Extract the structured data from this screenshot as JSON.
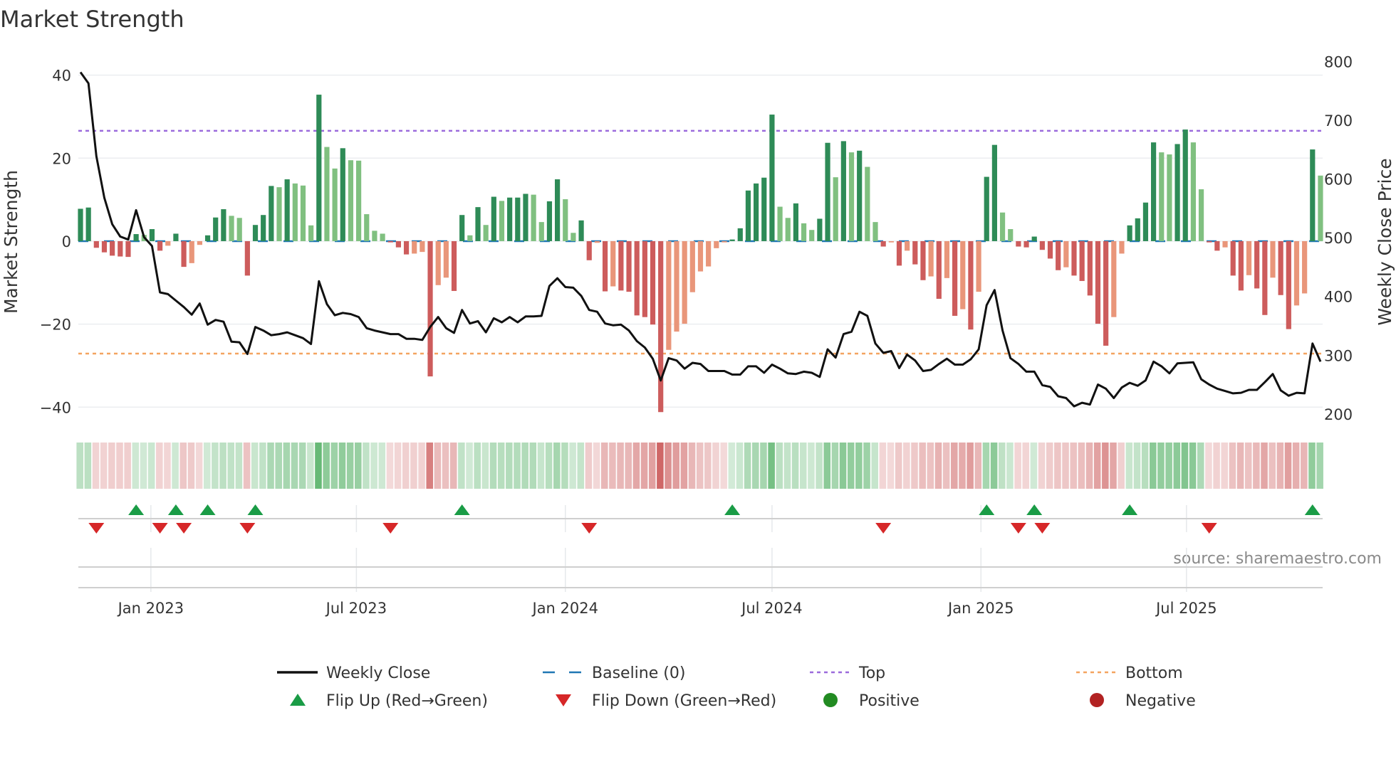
{
  "chart_data": {
    "type": "bar",
    "title": "Market Strength",
    "ylabel": "Market Strength",
    "y2label": "Weekly Close Price",
    "source": "source: sharemaestro.com",
    "x_start": "2022-10-31",
    "x_step_days": 7,
    "ylim": [
      -43.9,
      44.4
    ],
    "y2lim": [
      184,
      808
    ],
    "y_ticks": [
      -40,
      -20,
      0,
      20,
      40
    ],
    "y_tick_labels": [
      "−40",
      "−20",
      "0",
      "20",
      "40"
    ],
    "y2_ticks": [
      200,
      300,
      400,
      500,
      600,
      700,
      800
    ],
    "x_ticks": [
      {
        "label": "Jan 2023",
        "date": "2023-01-01"
      },
      {
        "label": "Jul 2023",
        "date": "2023-07-01"
      },
      {
        "label": "Jan 2024",
        "date": "2024-01-01"
      },
      {
        "label": "Jul 2024",
        "date": "2024-07-01"
      },
      {
        "label": "Jan 2025",
        "date": "2025-01-01"
      },
      {
        "label": "Jul 2025",
        "date": "2025-07-01"
      }
    ],
    "top_level": 26.6,
    "bottom_level": -27.1,
    "baseline": 0,
    "strength": [
      7.8,
      8.1,
      -1.6,
      -2.7,
      -3.5,
      -3.7,
      -3.8,
      1.7,
      1.5,
      2.9,
      -2.3,
      -1.1,
      1.8,
      -6.2,
      -5.3,
      -0.9,
      1.4,
      5.7,
      7.7,
      6.1,
      5.6,
      -8.3,
      3.9,
      6.3,
      13.3,
      13.0,
      14.9,
      13.9,
      13.4,
      3.8,
      35.3,
      22.7,
      17.5,
      22.4,
      19.5,
      19.4,
      6.5,
      2.5,
      1.8,
      -0.3,
      -1.5,
      -3.2,
      -3.0,
      -2.6,
      -32.6,
      -10.6,
      -8.8,
      -12.0,
      6.3,
      1.4,
      8.2,
      3.9,
      10.7,
      9.7,
      10.5,
      10.5,
      11.4,
      11.2,
      4.6,
      9.6,
      14.9,
      10.1,
      2.0,
      5.0,
      -4.6,
      -0.4,
      -12.1,
      -10.9,
      -11.9,
      -12.2,
      -17.9,
      -18.3,
      -20.1,
      -41.2,
      -26.2,
      -21.8,
      -19.9,
      -12.3,
      -7.3,
      -6.1,
      -1.7,
      -0.3,
      0.4,
      3.1,
      12.2,
      13.9,
      15.3,
      30.5,
      8.3,
      5.6,
      9.1,
      4.3,
      2.7,
      5.4,
      23.7,
      15.4,
      24.1,
      21.4,
      21.8,
      17.9,
      4.6,
      -1.3,
      -0.3,
      -5.9,
      -2.3,
      -5.6,
      -9.4,
      -8.5,
      -13.9,
      -8.9,
      -18.0,
      -16.4,
      -21.3,
      -12.2,
      15.5,
      23.2,
      6.9,
      2.9,
      -1.3,
      -1.5,
      1.1,
      -2.1,
      -4.2,
      -7.0,
      -6.3,
      -8.3,
      -9.6,
      -13.1,
      -19.9,
      -25.2,
      -18.3,
      -3.0,
      3.8,
      5.5,
      9.3,
      23.8,
      21.4,
      20.9,
      23.4,
      26.9,
      23.8,
      12.5,
      -0.3,
      -2.3,
      -1.5,
      -8.3,
      -11.9,
      -8.2,
      -11.4,
      -17.8,
      -8.8,
      -13.0,
      -21.2,
      -15.5,
      -12.6,
      22.1,
      15.8
    ],
    "weekly_close": [
      782,
      763,
      639,
      568,
      523,
      502,
      497,
      547,
      501,
      486,
      407,
      404,
      393,
      382,
      369,
      388,
      352,
      360,
      357,
      323,
      322,
      302,
      348,
      342,
      334,
      336,
      339,
      334,
      329,
      319,
      426,
      387,
      368,
      372,
      370,
      365,
      346,
      342,
      339,
      336,
      336,
      328,
      328,
      326,
      348,
      365,
      346,
      338,
      377,
      354,
      358,
      339,
      363,
      356,
      365,
      356,
      366,
      366,
      367,
      418,
      431,
      416,
      415,
      401,
      377,
      374,
      354,
      351,
      352,
      342,
      324,
      313,
      294,
      257,
      295,
      291,
      277,
      287,
      285,
      273,
      273,
      273,
      267,
      267,
      281,
      281,
      270,
      284,
      277,
      269,
      268,
      272,
      270,
      263,
      310,
      296,
      336,
      340,
      374,
      367,
      320,
      304,
      307,
      278,
      301,
      291,
      273,
      275,
      285,
      294,
      284,
      284,
      293,
      310,
      385,
      411,
      342,
      295,
      285,
      272,
      272,
      249,
      246,
      230,
      227,
      213,
      219,
      216,
      250,
      243,
      227,
      245,
      253,
      248,
      257,
      289,
      281,
      269,
      286,
      287,
      288,
      259,
      250,
      243,
      239,
      235,
      236,
      241,
      241,
      254,
      268,
      240,
      231,
      236,
      235,
      320,
      289
    ],
    "colors": {
      "pos_rising": "#2e8b57",
      "pos_falling": "#80c080",
      "neg_falling": "#cd5c5c",
      "neg_rising": "#e9967a",
      "line": "#111111",
      "baseline": "#1f77b4",
      "top": "#9b6bdc",
      "bottom": "#f4a460",
      "flip_up": "#1a9c46",
      "flip_down": "#d62728",
      "positive": "#228b22",
      "negative": "#b22222"
    },
    "legend": [
      {
        "label": "Weekly Close",
        "kind": "line"
      },
      {
        "label": "Baseline (0)",
        "kind": "baseline"
      },
      {
        "label": "Top",
        "kind": "top"
      },
      {
        "label": "Bottom",
        "kind": "bottom"
      },
      {
        "label": "Flip Up (Red→Green)",
        "kind": "flip_up"
      },
      {
        "label": "Flip Down (Green→Red)",
        "kind": "flip_down"
      },
      {
        "label": "Positive",
        "kind": "positive"
      },
      {
        "label": "Negative",
        "kind": "negative"
      }
    ]
  }
}
